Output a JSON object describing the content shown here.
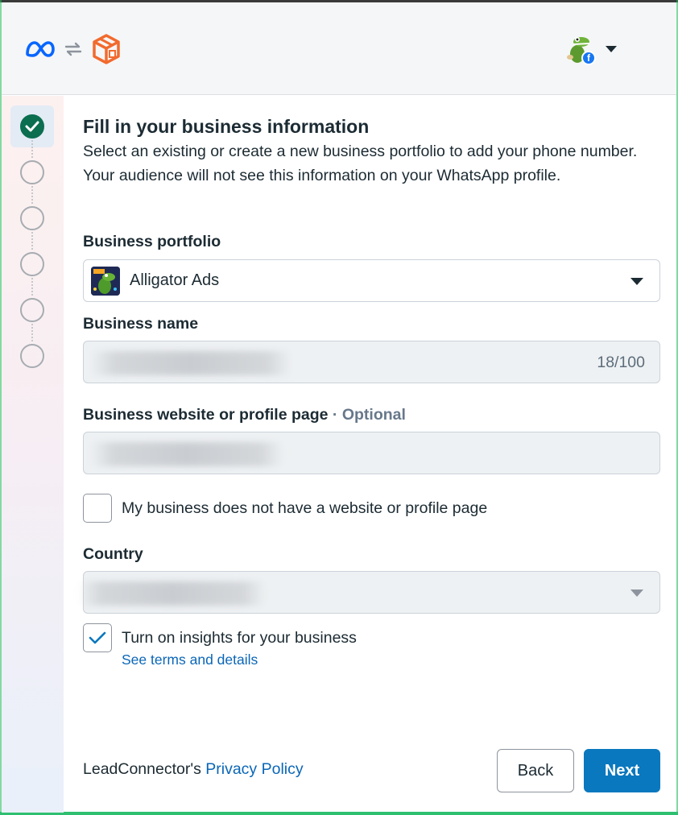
{
  "header": {
    "meta_logo": "meta-logo",
    "sync_icon": "sync-arrows-icon",
    "app_logo": "leadconnector-logo",
    "account_avatar": "alligator-avatar",
    "account_badge": "f",
    "account_menu_icon": "chevron-down-icon"
  },
  "stepper": {
    "steps": [
      "completed",
      "pending",
      "pending",
      "pending",
      "pending",
      "pending"
    ]
  },
  "form": {
    "title": "Fill in your business information",
    "subtitle": "Select an existing or create a new business portfolio to add your phone number. Your audience will not see this information on your WhatsApp profile.",
    "portfolio_label": "Business portfolio",
    "portfolio_value": "Alligator Ads",
    "business_name_label": "Business name",
    "business_name_counter": "18/100",
    "website_label": "Business website or profile page",
    "website_optional": "· Optional",
    "no_website_label": "My business does not have a website or profile page",
    "country_label": "Country",
    "insights_label": "Turn on insights for your business",
    "insights_link": "See terms and details"
  },
  "footer": {
    "privacy_prefix": "LeadConnector's ",
    "privacy_link": "Privacy Policy",
    "back_label": "Back",
    "next_label": "Next"
  },
  "colors": {
    "primary": "#0a78be",
    "link": "#0a66b7",
    "step_done": "#0b6e4f",
    "brand_meta": "#0866ff",
    "brand_app": "#f26a2e"
  }
}
